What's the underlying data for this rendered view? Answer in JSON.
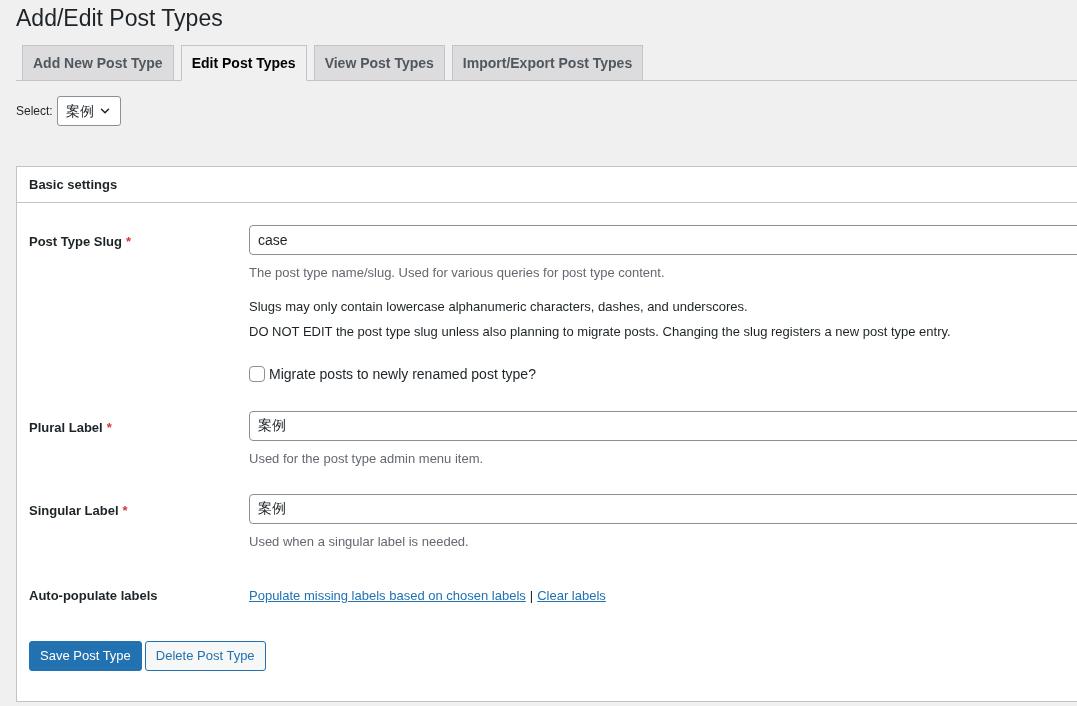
{
  "page_title": "Add/Edit Post Types",
  "tabs": [
    {
      "label": "Add New Post Type",
      "selected": false
    },
    {
      "label": "Edit Post Types",
      "selected": true
    },
    {
      "label": "View Post Types",
      "selected": false
    },
    {
      "label": "Import/Export Post Types",
      "selected": false
    }
  ],
  "select": {
    "label": "Select:",
    "value": "案例"
  },
  "panel": {
    "title": "Basic settings",
    "fields": [
      {
        "label": "Post Type Slug",
        "required_mark": "*",
        "value": "case",
        "help": [
          "The post type name/slug. Used for various queries for post type content."
        ],
        "notes": [
          "Slugs may only contain lowercase alphanumeric characters, dashes, and underscores.",
          "DO NOT EDIT the post type slug unless also planning to migrate posts. Changing the slug registers a new post type entry."
        ],
        "option": {
          "label": "Migrate posts to newly renamed post type?",
          "checked": false
        }
      },
      {
        "label": "Plural Label",
        "required_mark": "*",
        "value": "案例",
        "help": [
          "Used for the post type admin menu item."
        ]
      },
      {
        "label": "Singular Label",
        "required_mark": "*",
        "value": "案例",
        "help": [
          "Used when a singular label is needed."
        ]
      }
    ],
    "auto_populate": {
      "label": "Auto-populate labels",
      "links": [
        "Populate missing labels based on chosen labels",
        "Clear labels"
      ],
      "separator": "|"
    },
    "buttons": [
      {
        "label": "Save Post Type",
        "kind": "primary"
      },
      {
        "label": "Delete Post Type",
        "kind": "secondary"
      }
    ]
  }
}
